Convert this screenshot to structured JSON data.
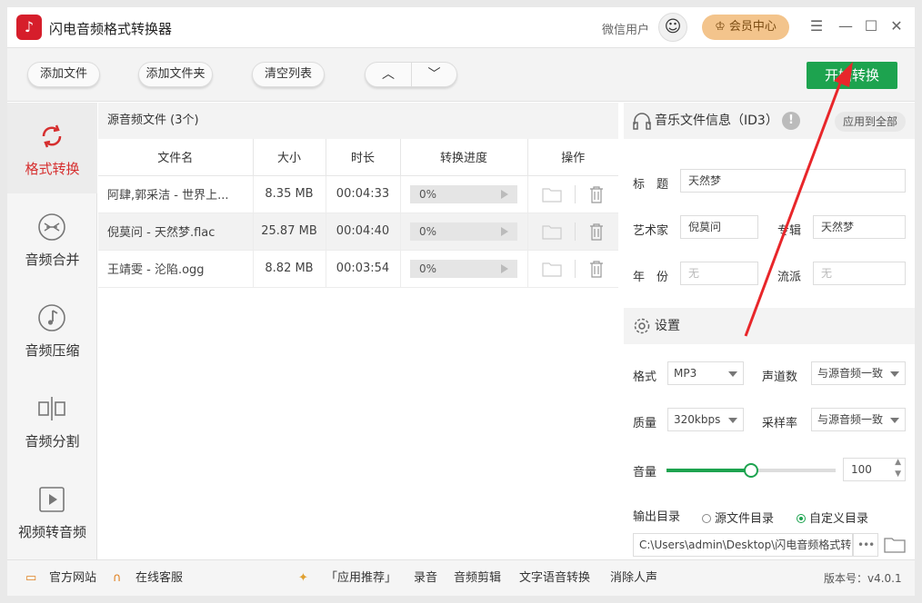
{
  "app": {
    "title": "闪电音频格式转换器",
    "user": "微信用户",
    "vip_label": "会员中心"
  },
  "toolbar": {
    "add_file": "添加文件",
    "add_folder": "添加文件夹",
    "clear_list": "清空列表",
    "start": "开始转换"
  },
  "sidebar": {
    "items": [
      {
        "label": "格式转换",
        "icon": "refresh-icon"
      },
      {
        "label": "音频合并",
        "icon": "merge-icon"
      },
      {
        "label": "音频压缩",
        "icon": "music-note-icon"
      },
      {
        "label": "音频分割",
        "icon": "split-icon"
      },
      {
        "label": "视频转音频",
        "icon": "video-play-icon"
      }
    ]
  },
  "file_list": {
    "title": "源音频文件 (3个)",
    "columns": [
      "文件名",
      "大小",
      "时长",
      "转换进度",
      "操作"
    ],
    "rows": [
      {
        "name": "阿肆,郭采洁 - 世界上...",
        "size": "8.35 MB",
        "duration": "00:04:33",
        "progress": "0%"
      },
      {
        "name": "倪莫问 - 天然梦.flac",
        "size": "25.87 MB",
        "duration": "00:04:40",
        "progress": "0%"
      },
      {
        "name": "王靖雯 - 沦陷.ogg",
        "size": "8.82 MB",
        "duration": "00:03:54",
        "progress": "0%"
      }
    ]
  },
  "id3": {
    "header": "音乐文件信息（ID3）",
    "apply_all": "应用到全部",
    "title_label": "标　题",
    "title_value": "天然梦",
    "artist_label": "艺术家",
    "artist_value": "倪莫问",
    "album_label": "专辑",
    "album_value": "天然梦",
    "year_label": "年　份",
    "year_placeholder": "无",
    "genre_label": "流派",
    "genre_placeholder": "无"
  },
  "settings": {
    "header": "设置",
    "format_label": "格式",
    "format_value": "MP3",
    "channels_label": "声道数",
    "channels_value": "与源音频一致",
    "quality_label": "质量",
    "quality_value": "320kbps",
    "samplerate_label": "采样率",
    "samplerate_value": "与源音频一致",
    "volume_label": "音量",
    "volume_value": "100",
    "volume_level": 0.5,
    "output_label": "输出目录",
    "opt_source": "源文件目录",
    "opt_custom": "自定义目录",
    "output_path": "C:\\Users\\admin\\Desktop\\闪电音频格式转",
    "browse": "•••"
  },
  "footer": {
    "website": "官方网站",
    "service": "在线客服",
    "recommend": "「应用推荐」",
    "links": [
      "录音",
      "音频剪辑",
      "文字语音转换",
      "消除人声"
    ],
    "version": "版本号：v4.0.1"
  },
  "colors": {
    "accent": "#1da34f",
    "active": "#d62f2f",
    "arrow": "#e8262a"
  }
}
